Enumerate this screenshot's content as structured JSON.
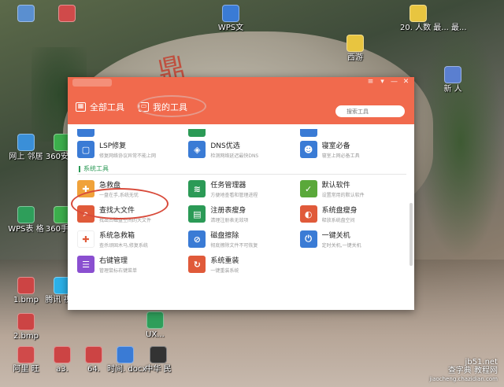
{
  "desktop": {
    "icons": [
      {
        "label": "",
        "icon": "app-icon",
        "color": "#5a8fd0"
      },
      {
        "label": "",
        "icon": "app-icon",
        "color": "#d04a4a"
      },
      {
        "label": "WPS文",
        "icon": "wps-icon",
        "color": "#3a7bd5"
      },
      {
        "label": "20. 人数 最... 最...",
        "icon": "doc-icon",
        "color": "#e8c540"
      },
      {
        "label": "西游",
        "icon": "folder-icon",
        "color": "#e8c540"
      },
      {
        "label": "网上 邻居",
        "icon": "network-icon",
        "color": "#3a8fd8"
      },
      {
        "label": "360安 全",
        "icon": "shield-icon",
        "color": "#3cae4c"
      },
      {
        "label": "WPS表 格",
        "icon": "wps-sheet-icon",
        "color": "#2e9e5a"
      },
      {
        "label": "360手 机",
        "icon": "phone-icon",
        "color": "#3cae4c"
      },
      {
        "label": "1.bmp",
        "icon": "image-icon",
        "color": "#cc4444"
      },
      {
        "label": "腾讯 视频",
        "icon": "video-icon",
        "color": "#2bb0e8"
      },
      {
        "label": "新 人",
        "icon": "doc-icon",
        "color": "#5a7fd0"
      },
      {
        "label": "2.bmp",
        "icon": "image-icon",
        "color": "#cc4444"
      },
      {
        "label": "UX...",
        "icon": "app-icon",
        "color": "#2e9e5a"
      },
      {
        "label": "阿里 旺",
        "icon": "chat-icon",
        "color": "#d04a4a"
      },
      {
        "label": "a3.",
        "icon": "image-icon",
        "color": "#cc4444"
      },
      {
        "label": "64.",
        "icon": "image-icon",
        "color": "#cc4444"
      },
      {
        "label": "时间. docx",
        "icon": "doc-icon",
        "color": "#3a7bd5"
      },
      {
        "label": "中华 民",
        "icon": "app-icon",
        "color": "#333333"
      }
    ]
  },
  "window": {
    "tabs": [
      {
        "label": "全部工具"
      },
      {
        "label": "我的工具"
      }
    ],
    "search_placeholder": "搜索工具",
    "controls": [
      "≡",
      "▾",
      "—",
      "✕"
    ],
    "rows_top_partial": [
      {
        "icon_color": "#3a7bd5"
      },
      {
        "icon_color": "#2b9a56"
      },
      {
        "icon_color": "#3a7bd5"
      }
    ],
    "rows_top": [
      [
        {
          "name": "LSP修复",
          "desc": "修复网络协议异常不能上网",
          "icon": "lsp-icon",
          "icon_color": "#3a7bd5",
          "glyph": "▢"
        },
        {
          "name": "DNS优选",
          "desc": "检测网络延迟最快DNS",
          "icon": "dns-icon",
          "icon_color": "#3a7bd5",
          "glyph": "◈"
        },
        {
          "name": "寝室必备",
          "desc": "寝室上网必备工具",
          "icon": "dorm-icon",
          "icon_color": "#3a7bd5",
          "glyph": "☻"
        }
      ]
    ],
    "section_system": "系统工具",
    "rows_system": [
      [
        {
          "name": "急救盘",
          "desc": "一盘在手,系统无忧",
          "icon": "rescue-disk-icon",
          "icon_color": "#f0a23a",
          "glyph": "✚"
        },
        {
          "name": "任务管理器",
          "desc": "方便地查看和管理进程",
          "icon": "task-manager-icon",
          "icon_color": "#2b9a56",
          "glyph": "≋"
        },
        {
          "name": "默认软件",
          "desc": "设置常用的默认软件",
          "icon": "default-software-icon",
          "icon_color": "#5aa83a",
          "glyph": "✓"
        }
      ],
      [
        {
          "name": "查找大文件",
          "desc": "找出占磁盘空间的大文件",
          "icon": "find-large-file-icon",
          "icon_color": "#e05a3a",
          "glyph": "⌕"
        },
        {
          "name": "注册表瘦身",
          "desc": "清理注册表无效项",
          "icon": "registry-icon",
          "icon_color": "#2b9a56",
          "glyph": "▤"
        },
        {
          "name": "系统盘瘦身",
          "desc": "释放系统盘空间",
          "icon": "system-disk-icon",
          "icon_color": "#e05a3a",
          "glyph": "◐"
        }
      ],
      [
        {
          "name": "系统急救箱",
          "desc": "查杀顽固木马,修复系统",
          "icon": "first-aid-icon",
          "icon_color": "#ffffff",
          "glyph": "✚"
        },
        {
          "name": "磁盘擦除",
          "desc": "彻底擦除文件不可恢复",
          "icon": "disk-erase-icon",
          "icon_color": "#3a7bd5",
          "glyph": "⊘"
        },
        {
          "name": "一键关机",
          "desc": "定时关机,一键关机",
          "icon": "shutdown-icon",
          "icon_color": "#3a7bd5",
          "glyph": "⏻"
        }
      ],
      [
        {
          "name": "右键管理",
          "desc": "管理鼠标右键菜单",
          "icon": "right-click-icon",
          "icon_color": "#8a4fd0",
          "glyph": "☰"
        },
        {
          "name": "系统重装",
          "desc": "一键重装系统",
          "icon": "reinstall-icon",
          "icon_color": "#e05a3a",
          "glyph": "↻"
        },
        {
          "name": "",
          "desc": "",
          "icon": "",
          "icon_color": "#ffffff",
          "glyph": ""
        }
      ]
    ]
  },
  "watermark": {
    "line1": "jb51.net",
    "line2": "查字典 教程网",
    "line3": "jiaocheng.chazidian.com"
  },
  "colors": {
    "header": "#f16a4d",
    "annotation": "#d84a3a",
    "section_label": "#2b9a56"
  }
}
